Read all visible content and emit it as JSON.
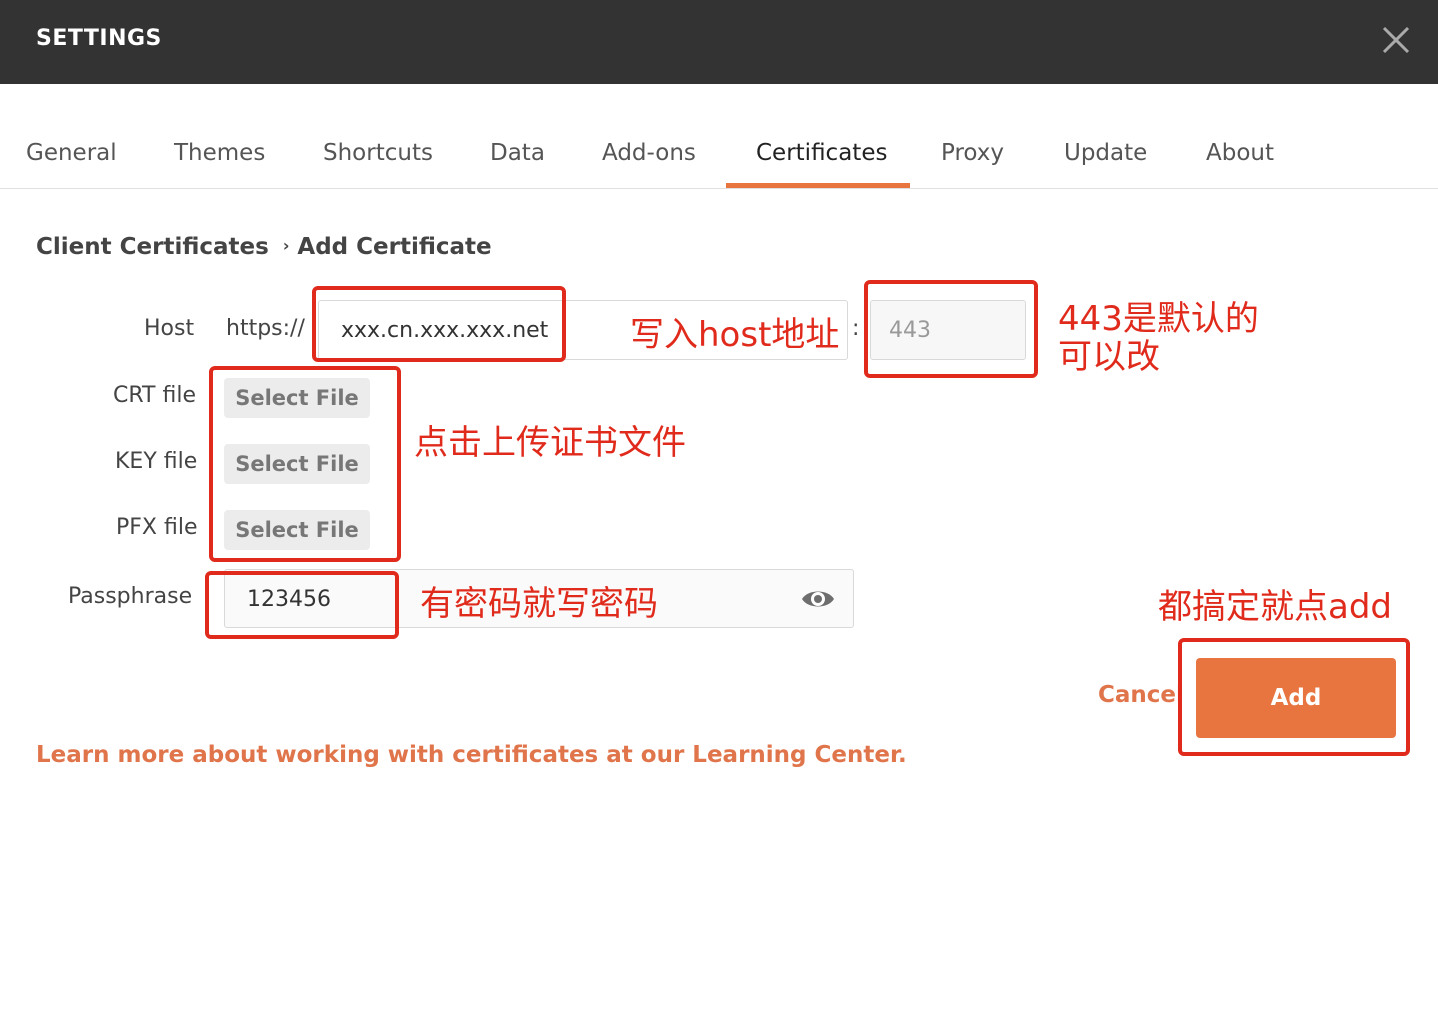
{
  "window": {
    "title": "SETTINGS",
    "close_icon": "close-icon"
  },
  "tabs": [
    {
      "label": "General",
      "active": false
    },
    {
      "label": "Themes",
      "active": false
    },
    {
      "label": "Shortcuts",
      "active": false
    },
    {
      "label": "Data",
      "active": false
    },
    {
      "label": "Add-ons",
      "active": false
    },
    {
      "label": "Certificates",
      "active": true
    },
    {
      "label": "Proxy",
      "active": false
    },
    {
      "label": "Update",
      "active": false
    },
    {
      "label": "About",
      "active": false
    }
  ],
  "breadcrumb": {
    "parent": "Client Certificates",
    "separator": "›",
    "current": "Add Certificate"
  },
  "form": {
    "host": {
      "label": "Host",
      "prefix": "https://",
      "value": "xxx.cn.xxx.xxx.net",
      "colon": ":",
      "port_placeholder": "443"
    },
    "crt": {
      "label": "CRT file",
      "button": "Select File"
    },
    "key": {
      "label": "KEY file",
      "button": "Select File"
    },
    "pfx": {
      "label": "PFX file",
      "button": "Select File"
    },
    "passphrase": {
      "label": "Passphrase",
      "value": "123456",
      "eye_icon": "eye-icon"
    }
  },
  "actions": {
    "cancel": "Cancel",
    "add": "Add"
  },
  "learn_link": "Learn more about working with certificates at our Learning Center.",
  "annotations": {
    "host": "写入host地址",
    "port_line1": "443是默认的",
    "port_line2": "可以改",
    "files": "点击上传证书文件",
    "passphrase": "有密码就写密码",
    "add": "都搞定就点add"
  },
  "colors": {
    "accent": "#e8743f",
    "titlebar": "#333333",
    "annotation": "#e02a1b"
  }
}
